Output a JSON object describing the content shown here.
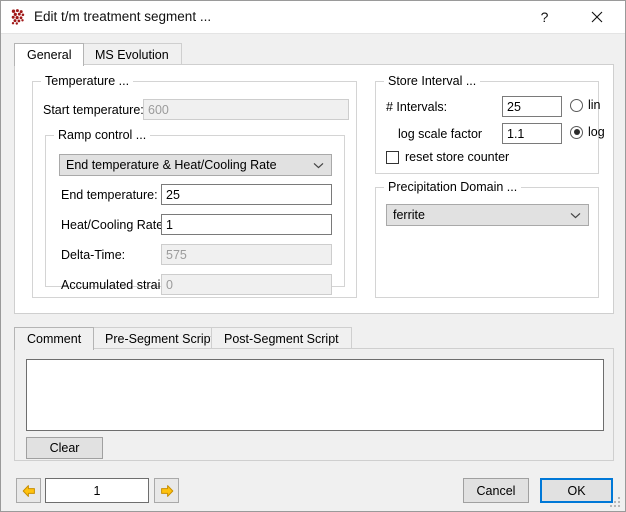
{
  "window": {
    "title": "Edit t/m treatment segment ...",
    "icon": "precipitate-cluster-icon",
    "help_label": "?",
    "close_label": "✕"
  },
  "tabs": {
    "items": [
      {
        "label": "General",
        "active": true
      },
      {
        "label": "MS Evolution",
        "active": false
      }
    ]
  },
  "temperature": {
    "group_label": "Temperature ...",
    "start_temperature": {
      "label": "Start temperature:",
      "value": "600",
      "disabled": true
    },
    "ramp_control": {
      "group_label": "Ramp control ...",
      "mode": {
        "value": "End temperature & Heat/Cooling Rate"
      },
      "end_temperature": {
        "label": "End temperature:",
        "value": "25",
        "disabled": false
      },
      "heat_cooling_rate": {
        "label": "Heat/Cooling Rate:",
        "value": "1",
        "disabled": false
      },
      "delta_time": {
        "label": "Delta-Time:",
        "value": "575",
        "disabled": true
      },
      "accumulated_strain": {
        "label": "Accumulated strain:",
        "value": "0",
        "disabled": true
      }
    }
  },
  "store_interval": {
    "group_label": "Store Interval ...",
    "intervals": {
      "label": "# Intervals:",
      "value": "25"
    },
    "log_scale_factor": {
      "label": "log scale factor",
      "value": "1.1"
    },
    "scale_lin": {
      "label": "lin",
      "selected": false
    },
    "scale_log": {
      "label": "log",
      "selected": true
    },
    "reset_store_counter": {
      "label": "reset store counter",
      "checked": false
    }
  },
  "precipitation_domain": {
    "group_label": "Precipitation Domain ...",
    "value": "ferrite"
  },
  "bottom_tabs": {
    "items": [
      {
        "label": "Comment",
        "active": true
      },
      {
        "label": "Pre-Segment Script",
        "active": false
      },
      {
        "label": "Post-Segment Script",
        "active": false
      }
    ],
    "comment_value": "",
    "clear_label": "Clear"
  },
  "footer": {
    "prev_label": "◀",
    "next_label": "▶",
    "segment_index": "1",
    "cancel_label": "Cancel",
    "ok_label": "OK"
  },
  "colors": {
    "accent": "#0078d7",
    "arrow": "#ffc20e",
    "icon_red": "#a01818"
  }
}
